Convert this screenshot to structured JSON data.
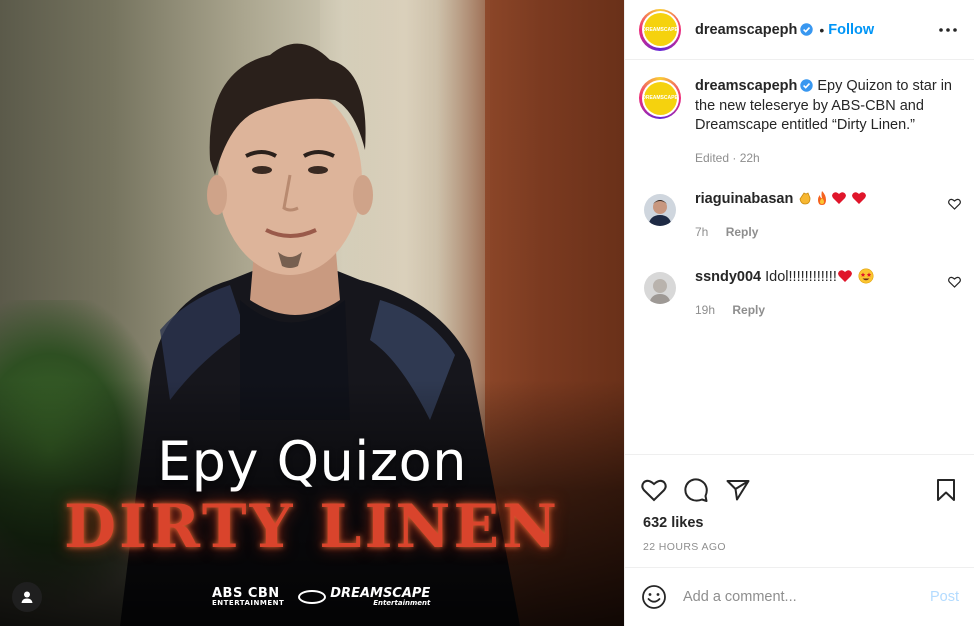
{
  "post": {
    "image": {
      "headline": "Epy Quizon",
      "show_title": "DIRTY LINEN",
      "logo_abs_line1": "ABS CBN",
      "logo_abs_line2": "ENTERTAINMENT",
      "logo_ds_line1": "DREAMSCAPE",
      "logo_ds_line2": "Entertainment"
    },
    "author": {
      "username": "dreamscapeph",
      "avatar_label": "DREAMSCAPE",
      "follow_label": "Follow",
      "separator": "•"
    },
    "caption": {
      "username": "dreamscapeph",
      "text": "Epy Quizon to star in the new teleserye by ABS-CBN and Dreamscape entitled “Dirty Linen.”",
      "edited": "Edited · 22h"
    },
    "comments": [
      {
        "username": "riaguinabasan",
        "text": "",
        "emojis": [
          "clap",
          "fire",
          "heart",
          "heart"
        ],
        "age": "7h",
        "reply_label": "Reply"
      },
      {
        "username": "ssndy004",
        "text": "Idol!!!!!!!!!!!!",
        "emojis": [
          "heart",
          "star-struck"
        ],
        "age": "19h",
        "reply_label": "Reply"
      }
    ],
    "likes": "632 likes",
    "time_ago": "22 HOURS AGO",
    "add_comment_placeholder": "Add a comment...",
    "post_label": "Post"
  },
  "colors": {
    "follow": "#0095f6",
    "verified": "#3897f0",
    "post_disabled": "#b3dbff",
    "meta_grey": "#8e8e8e"
  }
}
